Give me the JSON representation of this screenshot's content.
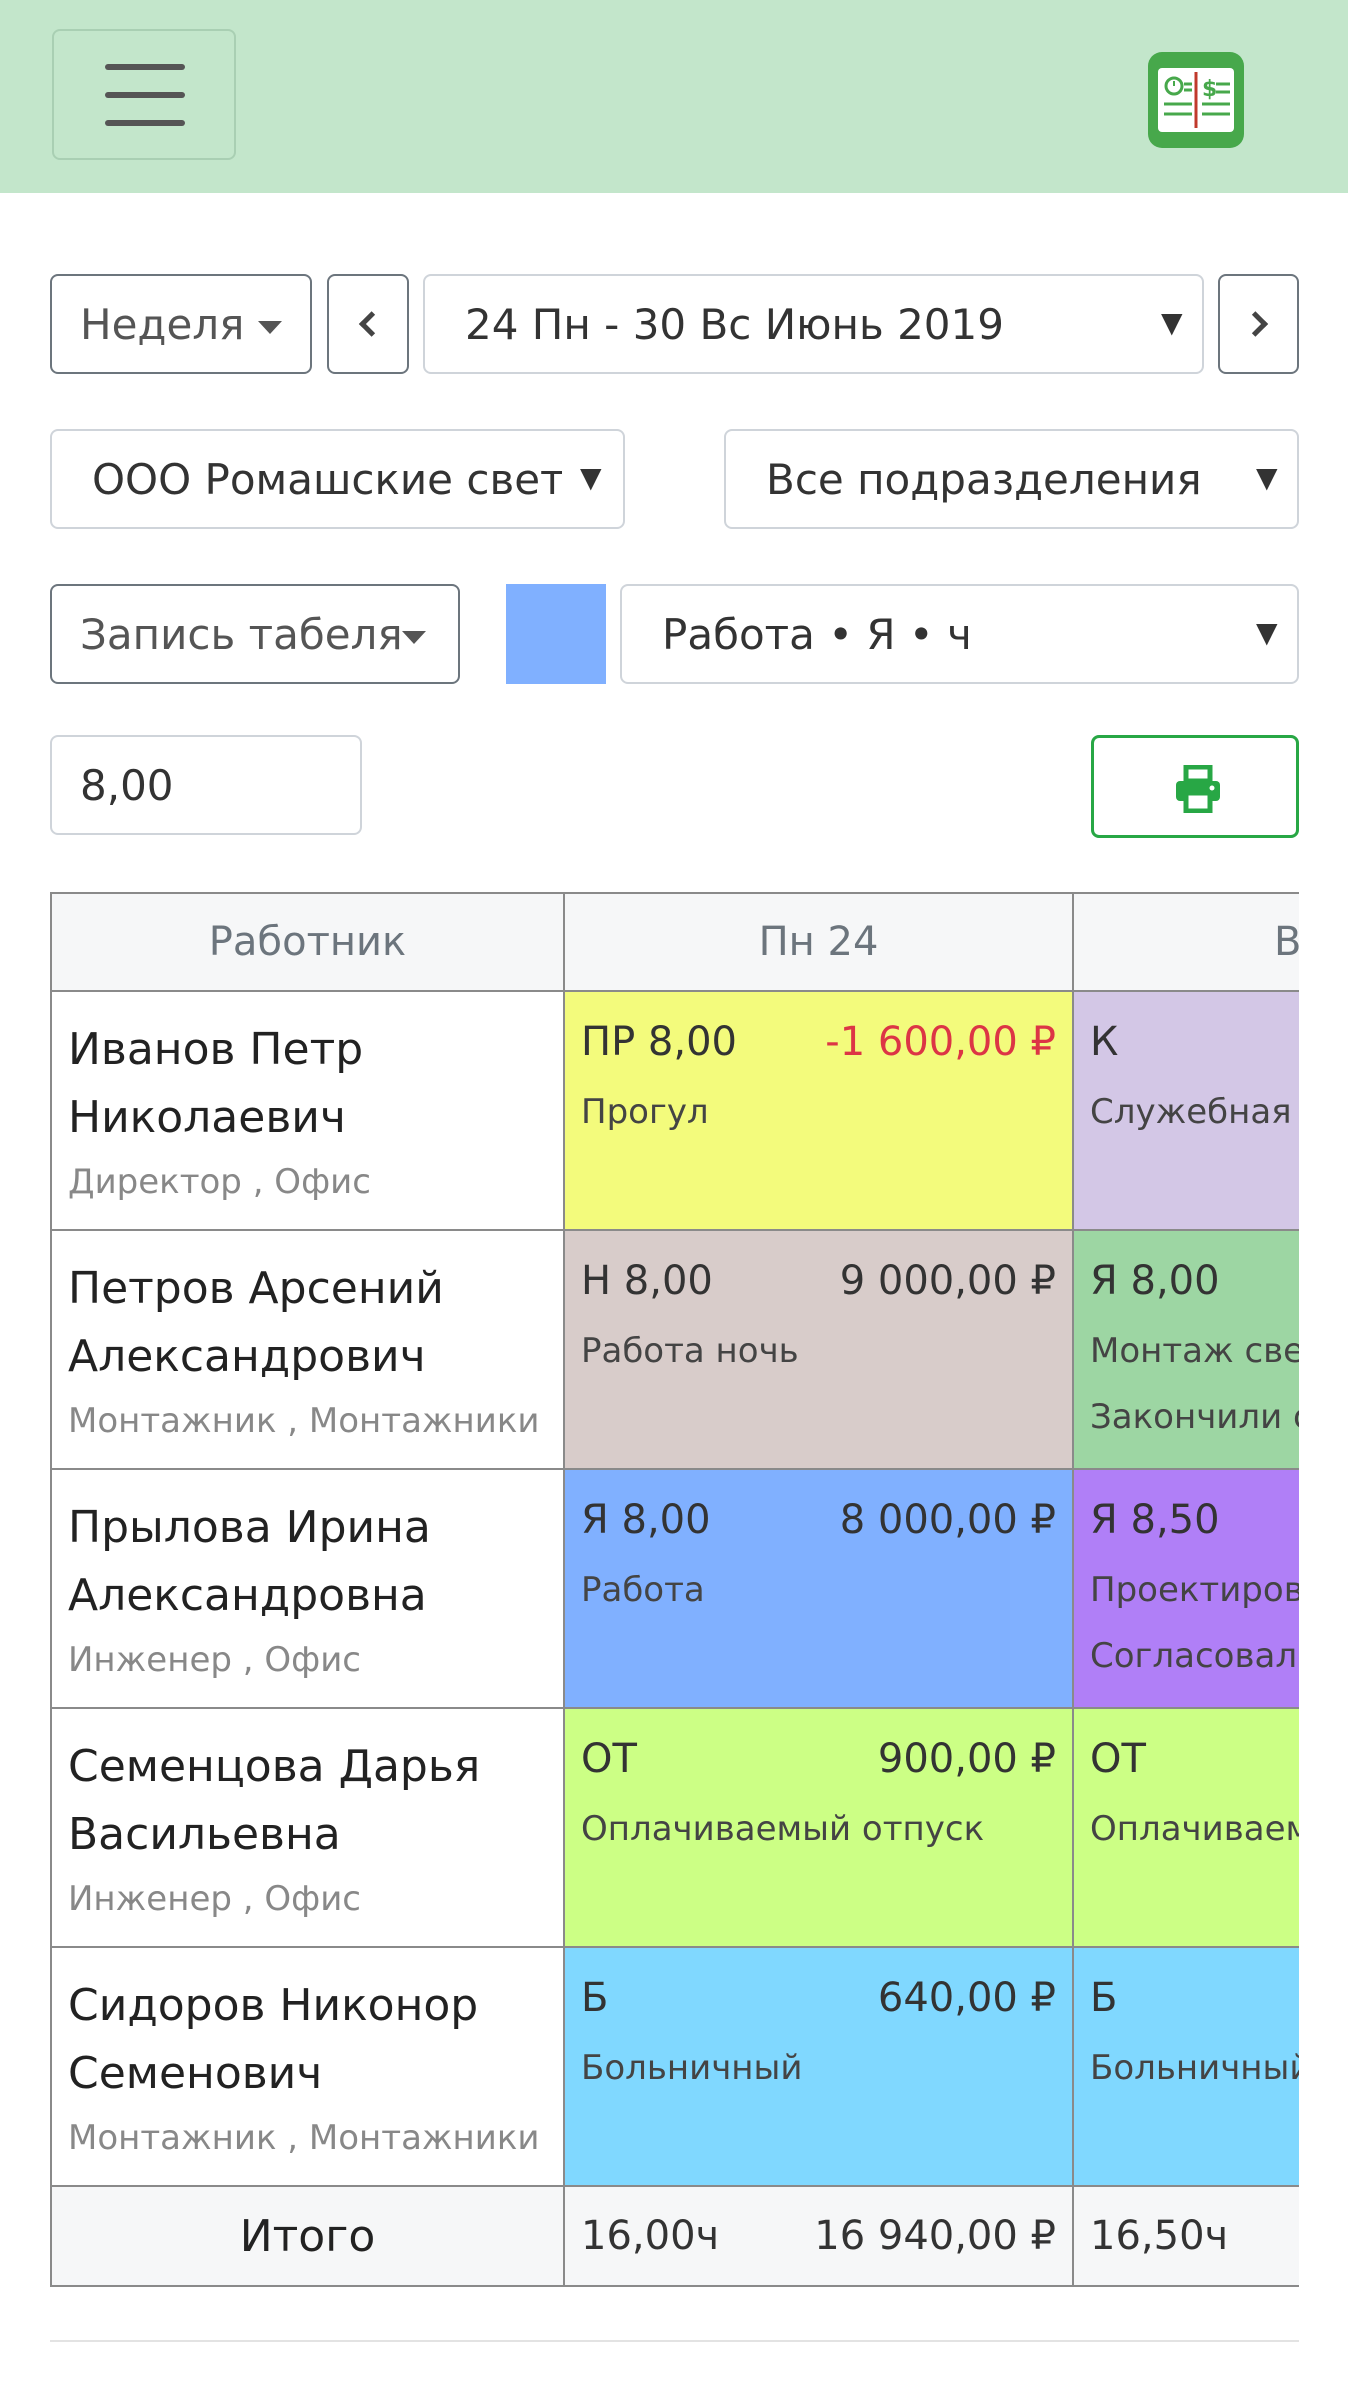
{
  "header": {
    "menu_icon": "hamburger-icon",
    "logo_icon": "timesheet-logo-icon",
    "colors": {
      "bar": "#c3e6cb",
      "logo": "#47a84b"
    }
  },
  "filters": {
    "period": "Неделя",
    "prev_icon": "chevron-left-icon",
    "range": "24 Пн - 30 Вс Июнь 2019",
    "next_icon": "chevron-right-icon",
    "company": "ООО Ромашские свет",
    "department": "Все подразделения",
    "mode": "Запись табеля",
    "work_type_color": "#80b0ff",
    "work_type": "Работа • Я • ч",
    "hours_value": "8,00",
    "print_icon": "printer-icon"
  },
  "table": {
    "headers": {
      "employee": "Работник",
      "day1": "Пн 24",
      "day2": "В"
    },
    "rows": [
      {
        "name": "Иванов Петр Николаевич",
        "position": "Директор , Офис",
        "day1": {
          "code": "ПР 8,00",
          "amount": "-1 600,00 ₽",
          "desc": "Прогул",
          "comment": "",
          "color": "#f3fb7c",
          "negative": true
        },
        "day2": {
          "code": "К",
          "desc": "Служебная к",
          "comment": "",
          "color": "#d3c7e6"
        }
      },
      {
        "name": "Петров Арсений Александрович",
        "position": "Монтажник , Монтажники",
        "day1": {
          "code": "Н 8,00",
          "amount": "9 000,00 ₽",
          "desc": "Работа ночь",
          "comment": "",
          "color": "#d8ccca",
          "negative": false
        },
        "day2": {
          "code": "Я 8,00",
          "desc": "Монтаж свет",
          "comment": "Закончили с",
          "color": "#9dd6a3"
        }
      },
      {
        "name": "Прылова Ирина Александровна",
        "position": "Инженер , Офис",
        "day1": {
          "code": "Я 8,00",
          "amount": "8 000,00 ₽",
          "desc": "Работа",
          "comment": "",
          "color": "#80b0ff",
          "negative": false
        },
        "day2": {
          "code": "Я 8,50",
          "desc": "Проектирова",
          "comment": "Согласовали",
          "color": "#b07ff7"
        }
      },
      {
        "name": "Семенцова Дарья Васильевна",
        "position": "Инженер , Офис",
        "day1": {
          "code": "ОТ",
          "amount": "900,00 ₽",
          "desc": "Оплачиваемый отпуск",
          "comment": "",
          "color": "#ccff85",
          "negative": false
        },
        "day2": {
          "code": "ОТ",
          "desc": "Оплачиваем",
          "comment": "",
          "color": "#ccff85"
        }
      },
      {
        "name": "Сидоров Никонор Семенович",
        "position": "Монтажник , Монтажники",
        "day1": {
          "code": "Б",
          "amount": "640,00 ₽",
          "desc": "Больничный",
          "comment": "",
          "color": "#80d8ff",
          "negative": false
        },
        "day2": {
          "code": "Б",
          "desc": "Больничный",
          "comment": "",
          "color": "#80d8ff"
        }
      }
    ],
    "total": {
      "label": "Итого",
      "day1_hours": "16,00ч",
      "day1_amount": "16 940,00 ₽",
      "day2_hours": "16,50ч"
    }
  }
}
